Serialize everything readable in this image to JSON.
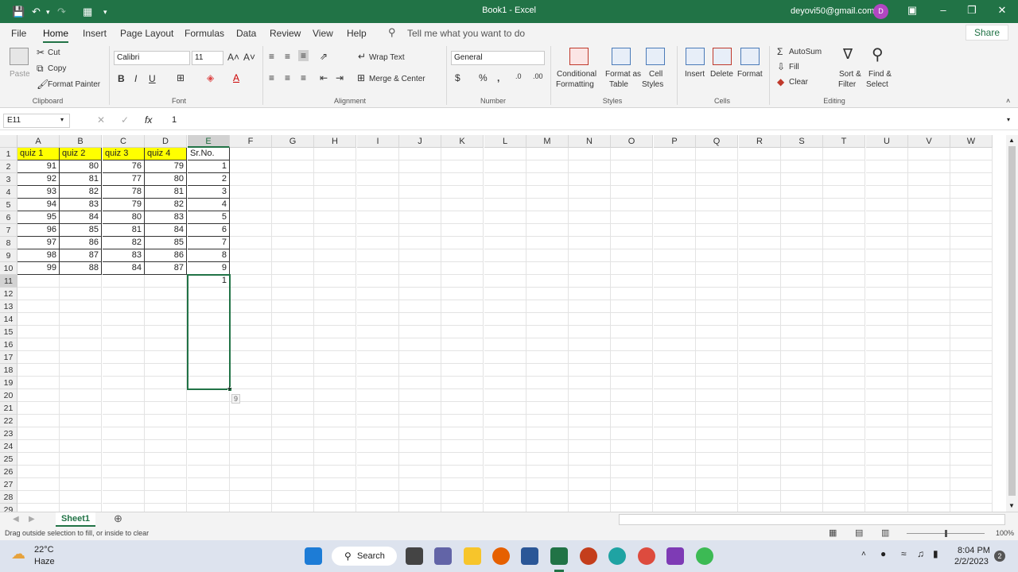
{
  "titlebar": {
    "title": "Book1 - Excel",
    "account": "deyovi50@gmail.com",
    "avatar_initial": "D"
  },
  "tabs": [
    "File",
    "Home",
    "Insert",
    "Page Layout",
    "Formulas",
    "Data",
    "Review",
    "View",
    "Help"
  ],
  "tell_me": "Tell me what you want to do",
  "share": "Share",
  "ribbon": {
    "clipboard": {
      "paste": "Paste",
      "cut": "Cut",
      "copy": "Copy",
      "format_painter": "Format Painter",
      "label": "Clipboard"
    },
    "font": {
      "name": "Calibri",
      "size": "11",
      "label": "Font"
    },
    "alignment": {
      "wrap_text": "Wrap Text",
      "merge_center": "Merge & Center",
      "label": "Alignment"
    },
    "number": {
      "format": "General",
      "label": "Number"
    },
    "styles": {
      "conditional_1": "Conditional",
      "conditional_2": "Formatting",
      "format_table_1": "Format as",
      "format_table_2": "Table",
      "cell_styles_1": "Cell",
      "cell_styles_2": "Styles",
      "label": "Styles"
    },
    "cells": {
      "insert": "Insert",
      "delete": "Delete",
      "format": "Format",
      "label": "Cells"
    },
    "editing": {
      "autosum": "AutoSum",
      "fill": "Fill",
      "clear": "Clear",
      "sort_1": "Sort &",
      "sort_2": "Filter",
      "find_1": "Find &",
      "find_2": "Select",
      "label": "Editing"
    }
  },
  "formula_bar": {
    "name_box": "E11",
    "fx": "fx",
    "value": "1"
  },
  "columns": [
    "A",
    "B",
    "C",
    "D",
    "E",
    "F",
    "G",
    "H",
    "I",
    "J",
    "K",
    "L",
    "M",
    "N",
    "O",
    "P",
    "Q",
    "R",
    "S",
    "T",
    "U",
    "V",
    "W"
  ],
  "rows": [
    "1",
    "2",
    "3",
    "4",
    "5",
    "6",
    "7",
    "8",
    "9",
    "10",
    "11",
    "12",
    "13",
    "14",
    "15",
    "16",
    "17",
    "18",
    "19",
    "20",
    "21",
    "22",
    "23",
    "24",
    "25",
    "26",
    "27",
    "28",
    "29"
  ],
  "grid": {
    "headers": [
      "quiz 1",
      "quiz 2",
      "quiz 3",
      "quiz 4",
      "Sr.No."
    ],
    "data": [
      [
        "91",
        "80",
        "76",
        "79",
        "1"
      ],
      [
        "92",
        "81",
        "77",
        "80",
        "2"
      ],
      [
        "93",
        "82",
        "78",
        "81",
        "3"
      ],
      [
        "94",
        "83",
        "79",
        "82",
        "4"
      ],
      [
        "95",
        "84",
        "80",
        "83",
        "5"
      ],
      [
        "96",
        "85",
        "81",
        "84",
        "6"
      ],
      [
        "97",
        "86",
        "82",
        "85",
        "7"
      ],
      [
        "98",
        "87",
        "83",
        "86",
        "8"
      ],
      [
        "99",
        "88",
        "84",
        "87",
        "9"
      ]
    ],
    "e11": "1",
    "fill_tooltip": "9"
  },
  "sheet_tab": "Sheet1",
  "status": {
    "message": "Drag outside selection to fill, or inside to clear",
    "zoom": "100%"
  },
  "taskbar": {
    "weather_temp": "22°C",
    "weather_desc": "Haze",
    "search": "Search",
    "time": "8:04 PM",
    "date": "2/2/2023",
    "notif": "2"
  },
  "colors": {
    "excel_green": "#217346",
    "header_fill": "#ffff00"
  }
}
